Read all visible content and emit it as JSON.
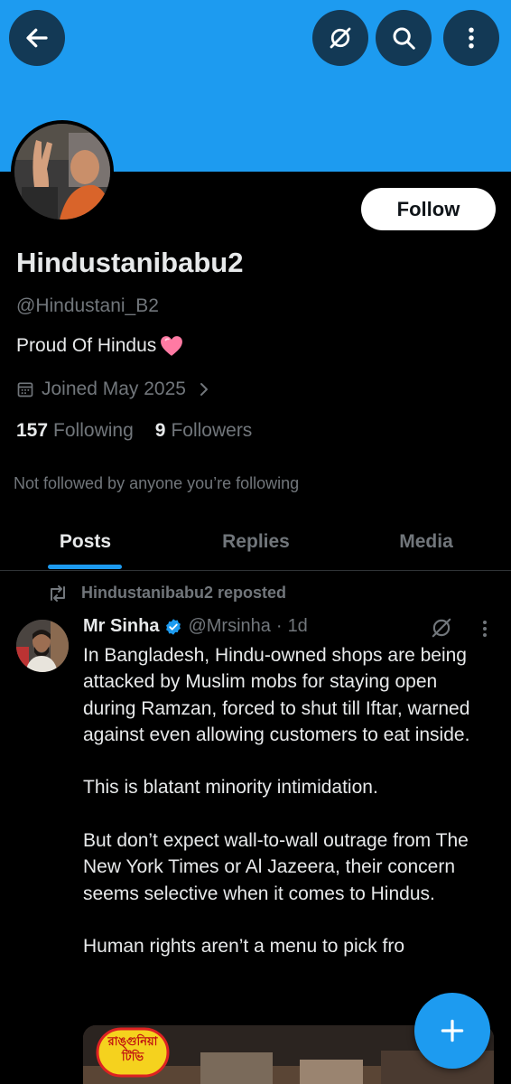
{
  "header": {
    "back_icon": "arrow-left-icon",
    "grok_icon": "grok-icon",
    "search_icon": "search-icon",
    "more_icon": "more-vertical-icon",
    "banner_color": "#1d9bf0"
  },
  "profile": {
    "follow_label": "Follow",
    "display_name": "Hindustanibabu2",
    "handle": "@Hindustani_B2",
    "bio": "Proud Of Hindus",
    "bio_emoji": "heart-icon",
    "joined": "Joined May 2025",
    "following_count": "157",
    "following_label": "Following",
    "followers_count": "9",
    "followers_label": "Followers",
    "not_followed": "Not followed by anyone you’re following"
  },
  "tabs": [
    {
      "label": "Posts",
      "active": true
    },
    {
      "label": "Replies",
      "active": false
    },
    {
      "label": "Media",
      "active": false
    }
  ],
  "post": {
    "repost_text": "Hindustanibabu2 reposted",
    "author_name": "Mr Sinha",
    "verified": true,
    "author_handle": "@Mrsinha",
    "separator": "·",
    "time": "1d",
    "paragraphs": [
      "In Bangladesh, Hindu-owned shops are being attacked by Muslim mobs for staying open during Ramzan, forced to shut till Iftar, warned against even allowing customers to eat inside.",
      "This is blatant minority intimidation.",
      "But don’t expect wall-to-wall outrage from The New York Times or Al Jazeera, their concern seems selective when it comes to Hindus.",
      "Human rights aren’t a menu to pick fro"
    ],
    "media_logo_text": "রাঙ্গুনিয়া টিভি"
  },
  "fab_icon": "plus-icon",
  "accent_color": "#1d9bf0"
}
